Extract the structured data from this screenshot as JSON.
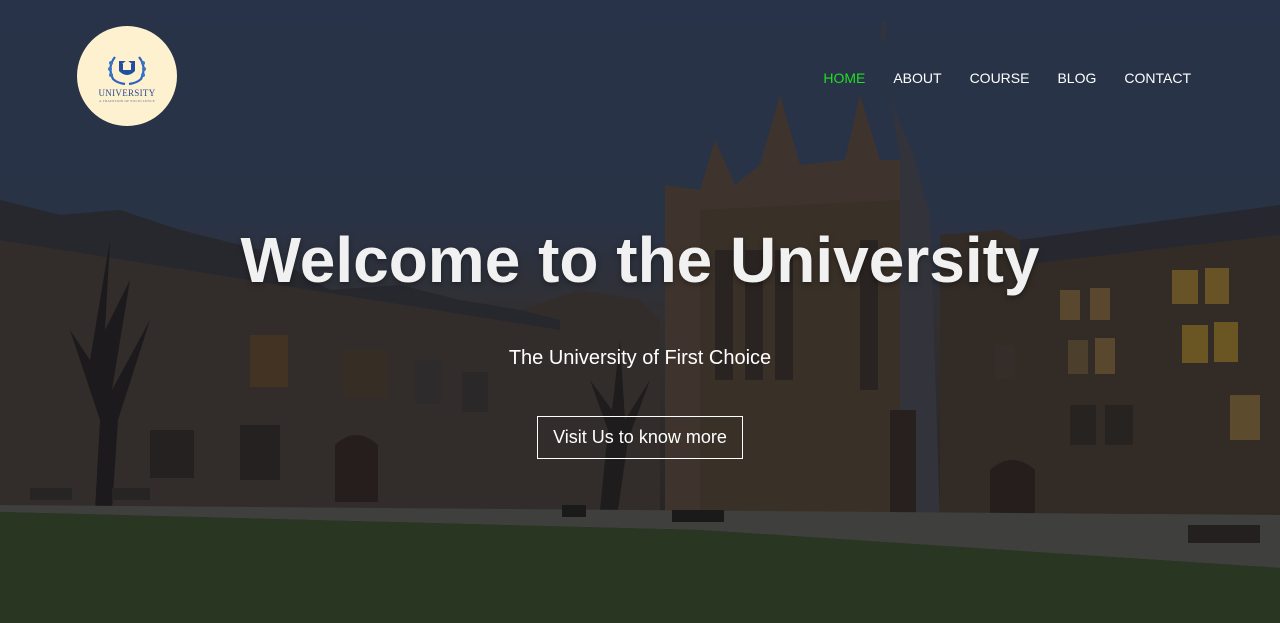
{
  "brand": {
    "name": "UNIVERSITY",
    "tagline": "A TRADITION OF EXCELLENCE",
    "badge_color": "#fdf1d0",
    "emblem_color": "#2b4a8c"
  },
  "nav": {
    "items": [
      {
        "label": "HOME",
        "active": true
      },
      {
        "label": "ABOUT",
        "active": false
      },
      {
        "label": "COURSE",
        "active": false
      },
      {
        "label": "BLOG",
        "active": false
      },
      {
        "label": "CONTACT",
        "active": false
      }
    ],
    "active_color": "#22dd22"
  },
  "hero": {
    "title": "Welcome to the University",
    "subtitle": "The University of First Choice",
    "cta_label": "Visit Us to know more",
    "background_image": "university-building-at-dusk"
  }
}
